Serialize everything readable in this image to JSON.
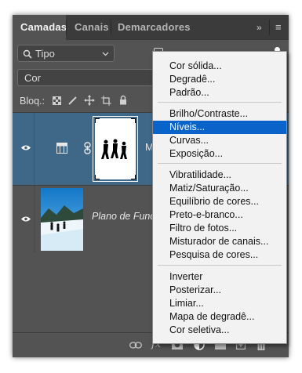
{
  "tabs": [
    "Camadas",
    "Canais",
    "Demarcadores"
  ],
  "filter_kind": "Tipo",
  "blend_mode": "Cor",
  "lock_label": "Bloq.:",
  "layers": [
    {
      "name": "M",
      "type": "adjustment-levels"
    },
    {
      "name": "Plano de Fundo",
      "type": "image"
    }
  ],
  "bottom_fx": "fx",
  "menu": {
    "groups": [
      [
        "Cor sólida...",
        "Degradê...",
        "Padrão..."
      ],
      [
        "Brilho/Contraste...",
        "Níveis...",
        "Curvas...",
        "Exposição..."
      ],
      [
        "Vibratilidade...",
        "Matiz/Saturação...",
        "Equilíbrio de cores...",
        "Preto-e-branco...",
        "Filtro de fotos...",
        "Misturador de canais...",
        "Pesquisa de cores..."
      ],
      [
        "Inverter",
        "Posterizar...",
        "Limiar...",
        "Mapa de degradê...",
        "Cor seletiva..."
      ]
    ],
    "selected": "Níveis...",
    "highlight_color": "#0a63c8"
  }
}
